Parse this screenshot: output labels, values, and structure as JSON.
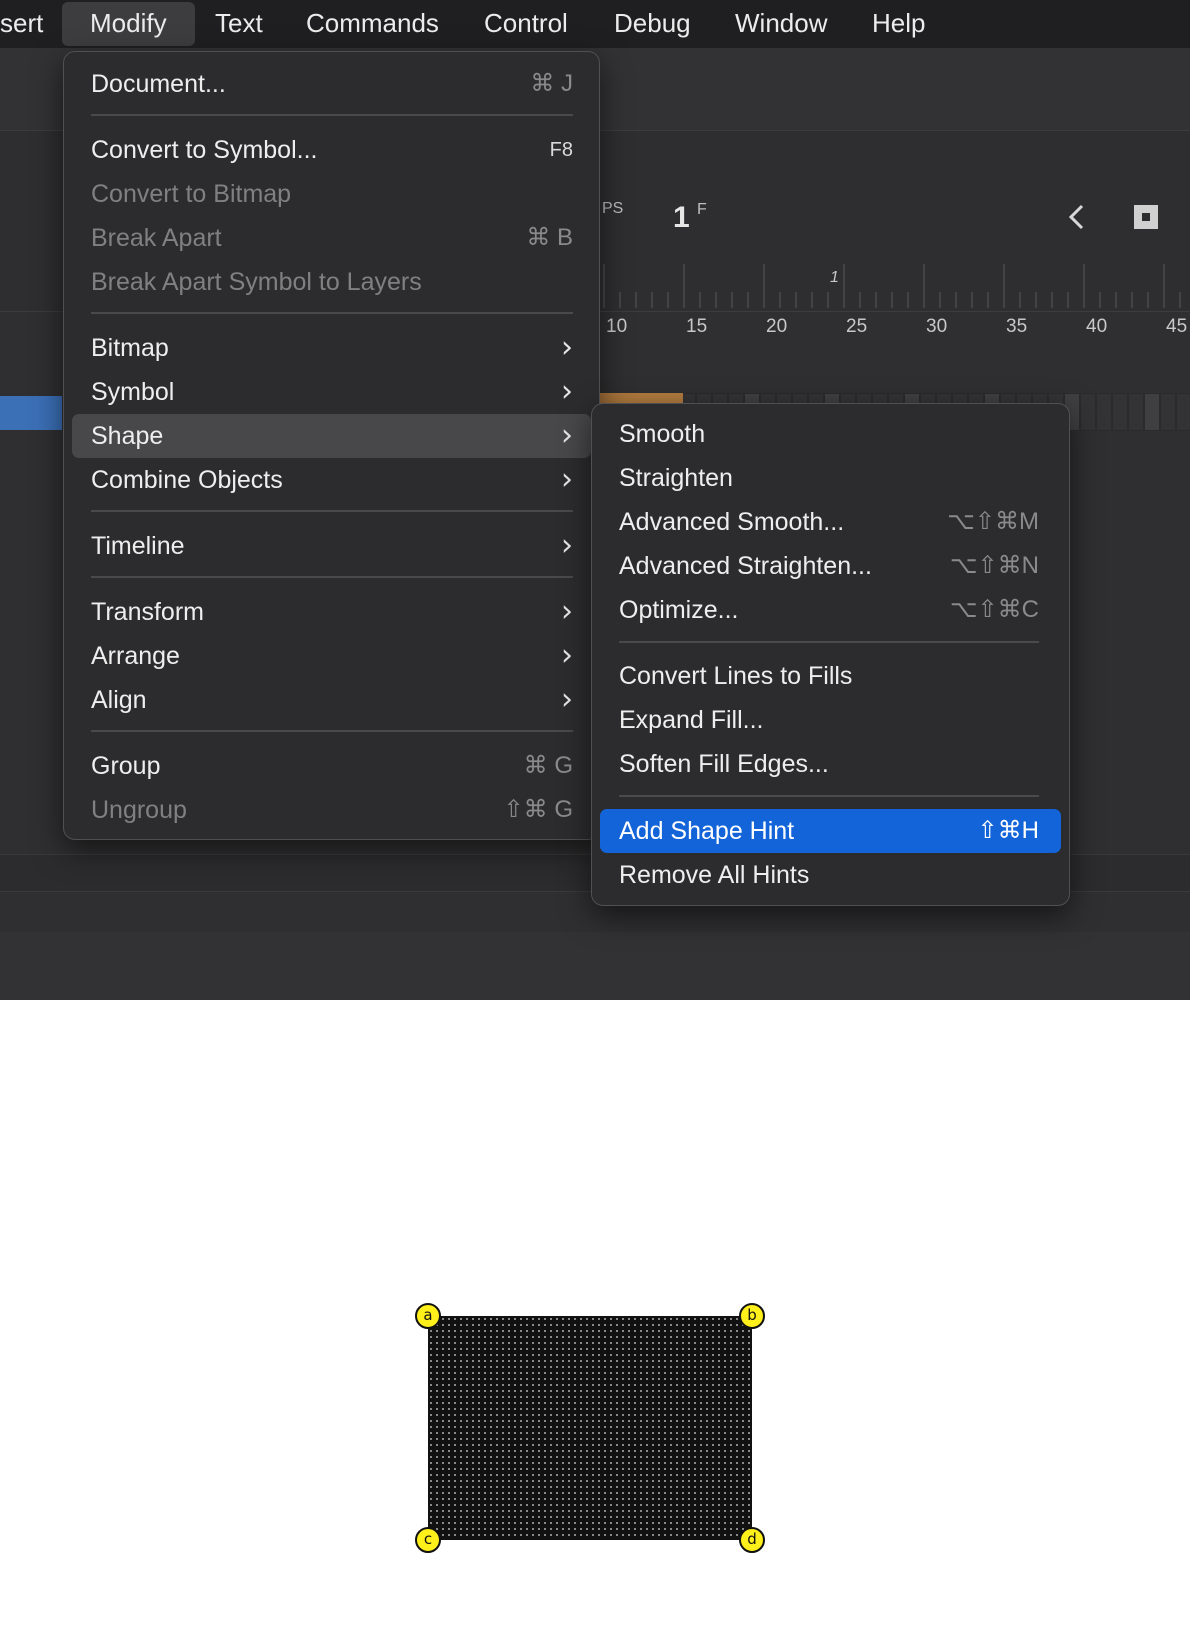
{
  "menubar": {
    "items": [
      "sert",
      "Modify",
      "Text",
      "Commands",
      "Control",
      "Debug",
      "Window",
      "Help"
    ]
  },
  "timeline": {
    "fps_partial": "PS",
    "frame_number": "1",
    "frame_suffix": "F",
    "ruler_marker": "1",
    "ticks": [
      "10",
      "15",
      "20",
      "25",
      "30",
      "35",
      "40",
      "45"
    ]
  },
  "modify_menu": {
    "items": [
      {
        "label": "Document...",
        "shortcut": "⌘ J",
        "enabled": true
      },
      {
        "label": "Convert to Symbol...",
        "shortcut": "F8",
        "enabled": true
      },
      {
        "label": "Convert to Bitmap",
        "shortcut": "",
        "enabled": false
      },
      {
        "label": "Break Apart",
        "shortcut": "⌘ B",
        "enabled": false
      },
      {
        "label": "Break Apart Symbol to Layers",
        "shortcut": "",
        "enabled": false
      },
      {
        "label": "Bitmap",
        "submenu": true,
        "enabled": true
      },
      {
        "label": "Symbol",
        "submenu": true,
        "enabled": true
      },
      {
        "label": "Shape",
        "submenu": true,
        "enabled": true,
        "highlighted": true
      },
      {
        "label": "Combine Objects",
        "submenu": true,
        "enabled": true
      },
      {
        "label": "Timeline",
        "submenu": true,
        "enabled": true
      },
      {
        "label": "Transform",
        "submenu": true,
        "enabled": true
      },
      {
        "label": "Arrange",
        "submenu": true,
        "enabled": true
      },
      {
        "label": "Align",
        "submenu": true,
        "enabled": true
      },
      {
        "label": "Group",
        "shortcut": "⌘ G",
        "enabled": true
      },
      {
        "label": "Ungroup",
        "shortcut": "⇧⌘ G",
        "enabled": false
      }
    ]
  },
  "shape_submenu": {
    "items": [
      {
        "label": "Smooth",
        "shortcut": ""
      },
      {
        "label": "Straighten",
        "shortcut": ""
      },
      {
        "label": "Advanced Smooth...",
        "shortcut": "⌥⇧⌘M"
      },
      {
        "label": "Advanced Straighten...",
        "shortcut": "⌥⇧⌘N"
      },
      {
        "label": "Optimize...",
        "shortcut": "⌥⇧⌘C"
      },
      {
        "label": "Convert Lines to Fills",
        "shortcut": ""
      },
      {
        "label": "Expand Fill...",
        "shortcut": ""
      },
      {
        "label": "Soften Fill Edges...",
        "shortcut": ""
      },
      {
        "label": "Add Shape Hint",
        "shortcut": "⇧⌘H",
        "highlighted": true
      },
      {
        "label": "Remove All Hints",
        "shortcut": ""
      }
    ]
  },
  "stage": {
    "hints": [
      "a",
      "b",
      "c",
      "d"
    ]
  },
  "colors": {
    "highlight_blue": "#1264d8",
    "tween_orange": "#b07a3e",
    "hint_yellow": "#ffef1a",
    "layer_blue": "#3b6fb6"
  }
}
